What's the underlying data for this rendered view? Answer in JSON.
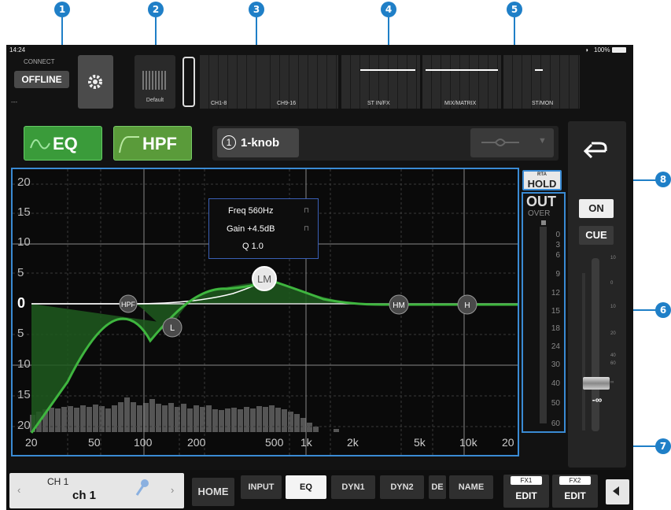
{
  "callouts": [
    "1",
    "2",
    "3",
    "4",
    "5",
    "6",
    "7",
    "8"
  ],
  "status": {
    "time": "14:24",
    "battery": "100%"
  },
  "connect": {
    "label": "CONNECT",
    "status": "OFFLINE",
    "sub": "---"
  },
  "scene": {
    "label": "Default"
  },
  "overview": {
    "sections": [
      "CH1-8",
      "CH9-16",
      "ST IN/FX",
      "MIX/MATRIX",
      "ST/MON"
    ]
  },
  "eq_button": {
    "label": "EQ"
  },
  "hpf_button": {
    "label": "HPF"
  },
  "eq_mode": {
    "number": "1",
    "label": "1-knob"
  },
  "param": {
    "freq": "Freq 560Hz",
    "gain": "Gain +4.5dB",
    "q": "Q  1.0"
  },
  "nodes": {
    "hpf": "HPF",
    "l": "L",
    "lm": "LM",
    "hm": "HM",
    "h": "H"
  },
  "graph": {
    "y_ticks": [
      "20",
      "15",
      "10",
      "5",
      "0",
      "5",
      "10",
      "15",
      "20"
    ],
    "x_ticks": [
      "20",
      "50",
      "100",
      "200",
      "500",
      "1k",
      "2k",
      "5k",
      "10k",
      "20"
    ]
  },
  "rta": {
    "small": "RTA",
    "label": "HOLD"
  },
  "meter": {
    "title": "OUT",
    "over": "OVER",
    "scale": [
      "0",
      "3",
      "6",
      "9",
      "12",
      "15",
      "18",
      "24",
      "30",
      "40",
      "50",
      "60"
    ]
  },
  "channel_controls": {
    "on": "ON",
    "cue": "CUE",
    "fader_value": "-∞",
    "fader_scale": [
      "10",
      "0",
      "10",
      "20",
      "40",
      "60",
      "∞"
    ]
  },
  "bottom": {
    "channel_num": "CH 1",
    "channel_name": "ch 1",
    "tabs": [
      "HOME",
      "INPUT",
      "EQ",
      "DYN1",
      "DYN2",
      "DE",
      "NAME"
    ],
    "fx1": "FX1",
    "fx2": "FX2",
    "edit": "EDIT"
  },
  "colors": {
    "accent_green": "#3da83d",
    "callout_blue": "#1f7fc7",
    "curve": "#3fb63f"
  }
}
